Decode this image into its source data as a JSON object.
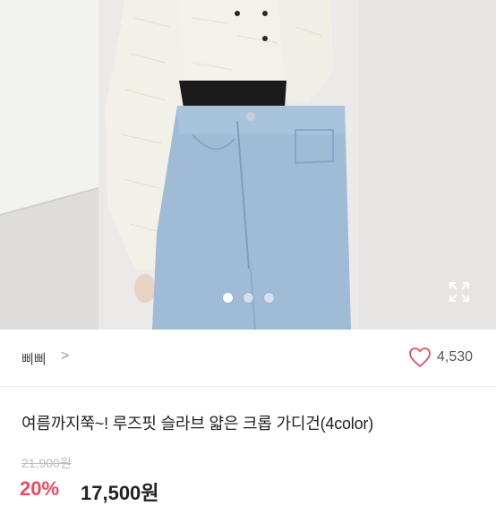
{
  "hero": {
    "image_alt": "상품 이미지",
    "slide_dots": 3,
    "active_slide": 1,
    "expand_icon": "expand-icon"
  },
  "store": {
    "name": "삐삐",
    "chevron": ">",
    "likes": "4,530",
    "heart_icon": "heart-outline-icon"
  },
  "product": {
    "title": "여름까지쭉~! 루즈핏 슬라브 얇은 크롭 가디건(4color)",
    "original_price": "21,900원",
    "discount": "20%",
    "price": "17,500원"
  },
  "colors": {
    "accent": "#f0485f",
    "heart": "#e3505e"
  }
}
